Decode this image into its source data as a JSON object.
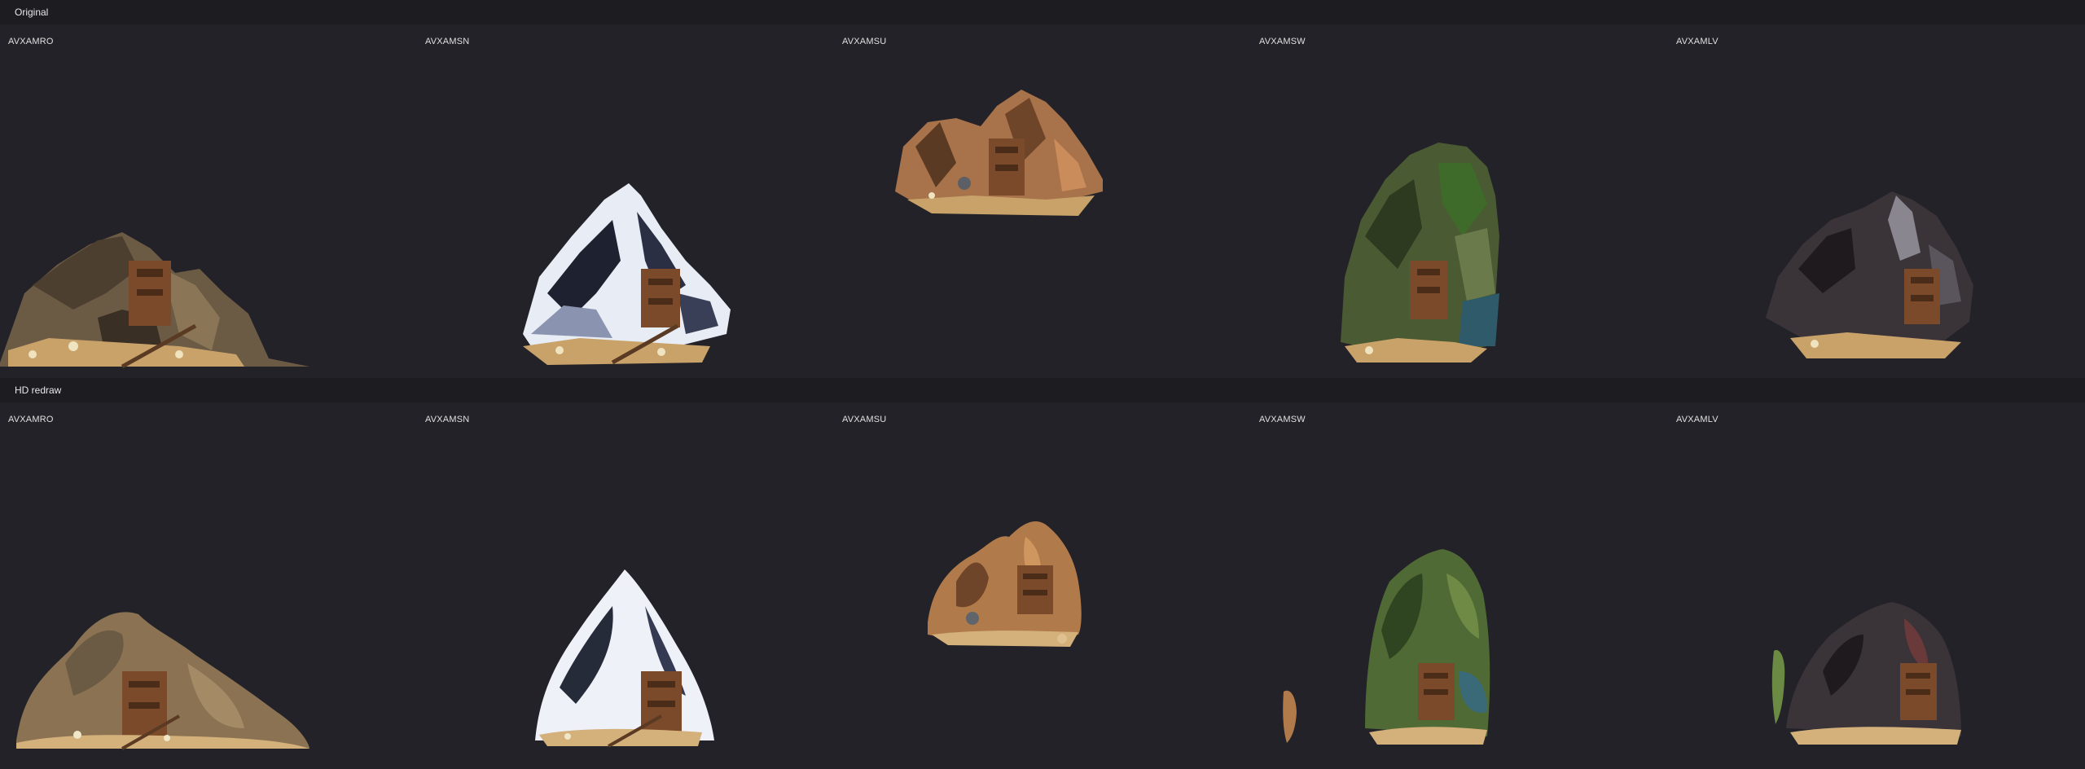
{
  "sections": {
    "original": {
      "title": "Original"
    },
    "hd": {
      "title": "HD redraw"
    }
  },
  "original_cells": [
    {
      "label": "AVXAMRO",
      "terrain": "rough"
    },
    {
      "label": "AVXAMSN",
      "terrain": "snow"
    },
    {
      "label": "AVXAMSU",
      "terrain": "subterranean"
    },
    {
      "label": "AVXAMSW",
      "terrain": "swamp"
    },
    {
      "label": "AVXAMLV",
      "terrain": "lava"
    }
  ],
  "hd_cells": [
    {
      "label": "AVXAMRO",
      "terrain": "rough"
    },
    {
      "label": "AVXAMSN",
      "terrain": "snow"
    },
    {
      "label": "AVXAMSU",
      "terrain": "subterranean"
    },
    {
      "label": "AVXAMSW",
      "terrain": "swamp"
    },
    {
      "label": "AVXAMLV",
      "terrain": "lava"
    }
  ],
  "colors": {
    "background": "#222228",
    "header_background": "#1c1c21",
    "rough_rock": "#6b5a44",
    "snow_rock": "#e8ecf4",
    "subterranean_rock": "#a8724a",
    "swamp_moss": "#3f6b2a",
    "lava_rock": "#3a3338",
    "mine_wood": "#7a4a2a",
    "ground_sand": "#c9a26a"
  }
}
